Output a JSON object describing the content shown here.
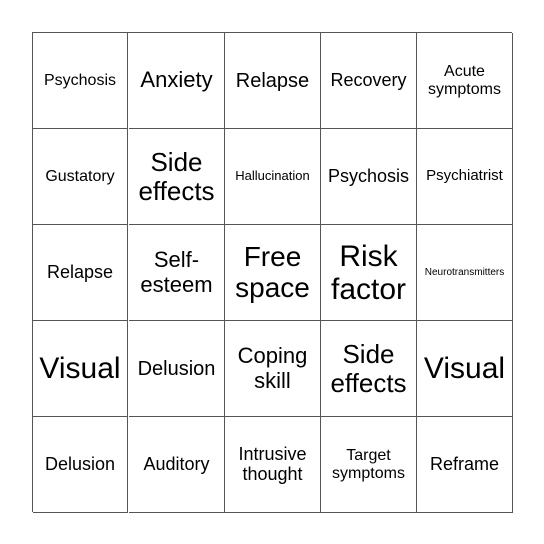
{
  "bingo": {
    "cells": [
      "Psychosis",
      "Anxiety",
      "Relapse",
      "Recovery",
      "Acute symptoms",
      "Gustatory",
      "Side effects",
      "Hallucination",
      "Psychosis",
      "Psychiatrist",
      "Relapse",
      "Self-esteem",
      "Free space",
      "Risk factor",
      "Neurotransmitters",
      "Visual",
      "Delusion",
      "Coping skill",
      "Side effects",
      "Visual",
      "Delusion",
      "Auditory",
      "Intrusive thought",
      "Target symptoms",
      "Reframe"
    ]
  }
}
